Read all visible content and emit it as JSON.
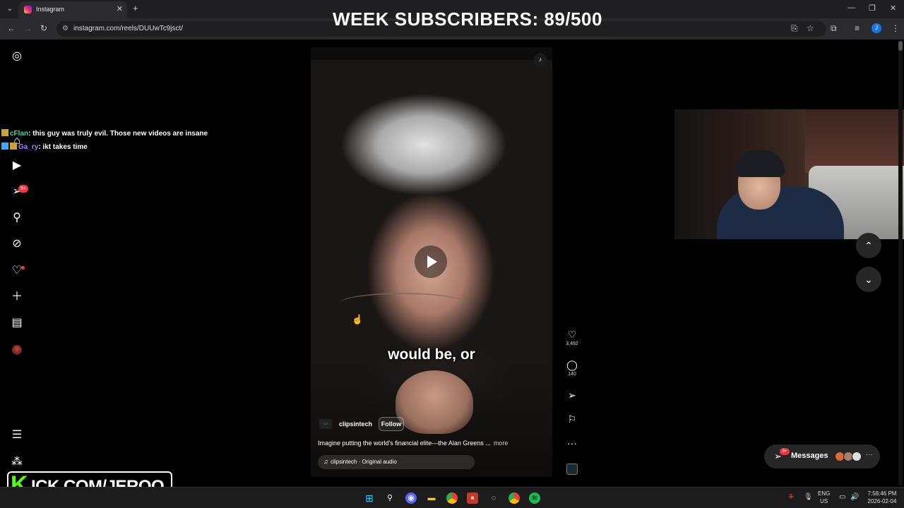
{
  "browser": {
    "tab_title": "Instagram",
    "url": "instagram.com/reels/DUUwTc9jsct/"
  },
  "overlay": {
    "subscribers_goal": "WEEK SUBSCRIBERS: 89/500"
  },
  "sidebar": {
    "notifications_badge": "9+"
  },
  "chat": [
    {
      "user": "cFlan",
      "message": ": this guy was truly evil. Those new videos are insane"
    },
    {
      "user": "Ga_ry",
      "message": ": ikt takes time"
    }
  ],
  "reel": {
    "caption": "would be, or",
    "creator": "clipsintech",
    "follow_label": "Follow",
    "description": "Imagine putting the world's financial elite—the Alan Greens ...",
    "more_label": "more",
    "audio": "clipsintech · Original audio"
  },
  "actions": {
    "likes": "3,492",
    "comments": "140"
  },
  "messages": {
    "label": "Messages",
    "badge": "9+"
  },
  "kick": {
    "k": "K",
    "url": "ICK.COM/JERQO"
  },
  "taskbar": {
    "lang_top": "ENG",
    "lang_bottom": "US",
    "time": "7:58:46 PM",
    "date": "2026-02-04"
  },
  "colors": {
    "instagram_red": "#ff3040",
    "kick_green": "#53fc18"
  }
}
